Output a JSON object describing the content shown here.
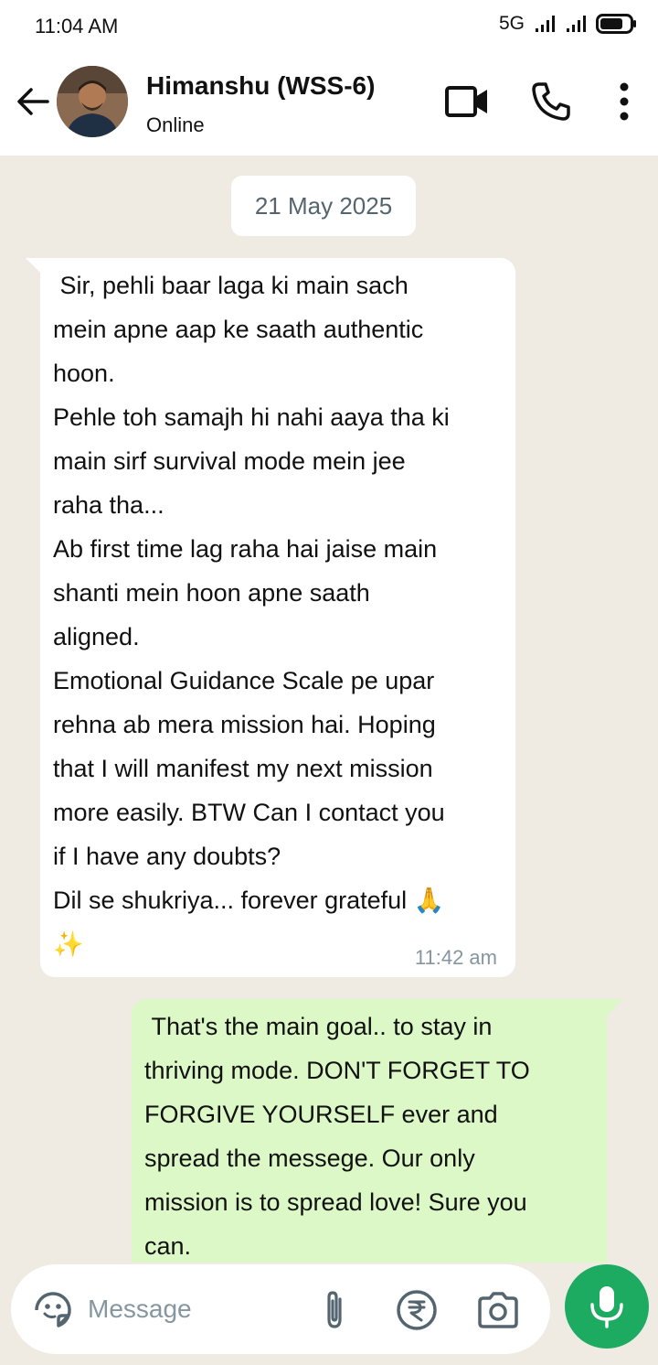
{
  "status_bar": {
    "time": "11:04 AM",
    "network": "5G"
  },
  "header": {
    "name": "Himanshu (WSS-6)",
    "status": "Online"
  },
  "chat": {
    "date": "21 May 2025",
    "messages": [
      {
        "direction": "incoming",
        "text": " Sir, pehli baar laga ki main sach\nmein apne aap ke saath authentic\nhoon.\nPehle toh samajh hi nahi aaya tha ki\nmain sirf survival mode mein jee\nraha tha...\nAb first time lag raha hai jaise main\nshanti mein hoon apne saath\naligned.\nEmotional Guidance Scale pe upar\nrehna ab mera mission hai. Hoping\nthat I will manifest my next mission\nmore easily. BTW Can I contact you\nif I have any doubts?\nDil se shukriya... forever grateful 🙏\n✨",
        "time": "11:42 am"
      },
      {
        "direction": "outgoing",
        "text": " That's the main goal.. to stay in\nthriving mode. DON'T FORGET TO\nFORGIVE YOURSELF ever and\nspread the messege. Our only\nmission is to spread love! Sure you\ncan."
      }
    ]
  },
  "composer": {
    "placeholder": "Message"
  },
  "colors": {
    "chat_bg": "#efeae2",
    "outgoing_bubble": "#dcf8c6",
    "mic_green": "#1daa61",
    "meta_gray": "#8696a0"
  }
}
